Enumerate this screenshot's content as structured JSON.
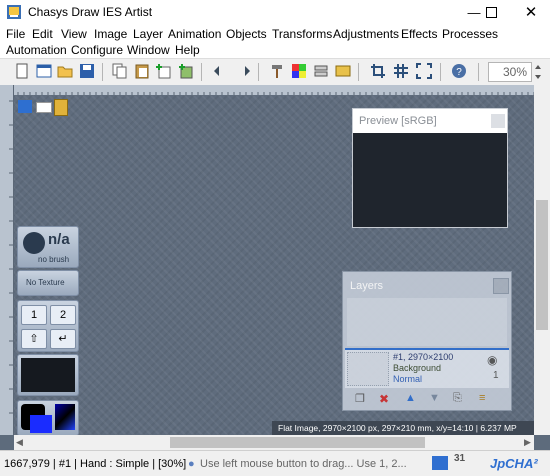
{
  "window": {
    "title": "Chasys Draw IES Artist"
  },
  "menu": {
    "row1": [
      "File",
      "Edit",
      "View",
      "Image",
      "Layer",
      "Animation",
      "Objects",
      "Transforms",
      "Adjustments",
      "Effects",
      "Processes"
    ],
    "row2": [
      "Automation",
      "Configure",
      "Window",
      "Help"
    ]
  },
  "toolbar": {
    "zoom": "30%"
  },
  "preview": {
    "title": "Preview [sRGB]"
  },
  "brush": {
    "size": "n/a",
    "label": "no brush"
  },
  "texture": {
    "label": "No Texture"
  },
  "stepper": {
    "one": "1",
    "two": "2"
  },
  "layers": {
    "title": "Layers",
    "item": {
      "name": "#1, 2970×2100",
      "type": "Background",
      "blend": "Normal",
      "link_count": "1"
    }
  },
  "canvas_info": "Flat Image, 2970×2100 px, 297×210 mm, x/y=14:10 | 6.237 MP",
  "status": {
    "text": "1667,979 | #1 | Hand : Simple | [30%]",
    "hint": "Use left mouse button to drag... Use 1, 2...",
    "badge": "31",
    "brand": "JpCHA²"
  },
  "colors": {
    "accent": "#2f6fd0",
    "canvas": "#5f6c7d",
    "preview_bg": "#1f252d"
  }
}
